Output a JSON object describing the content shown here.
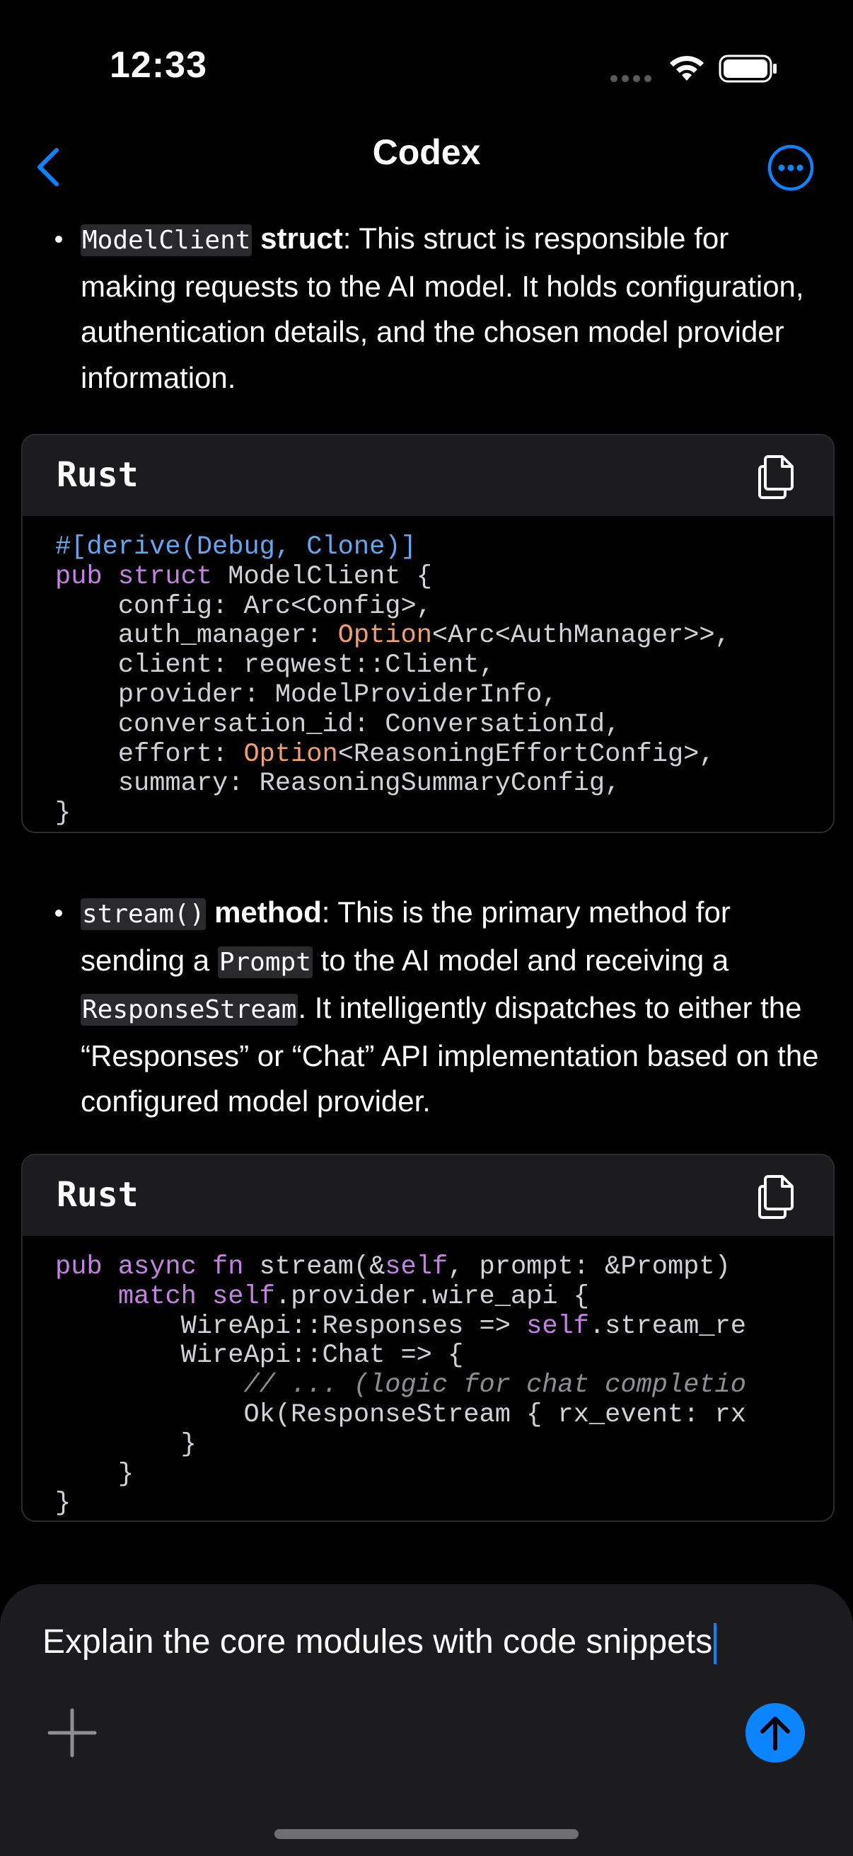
{
  "status_bar": {
    "time": "12:33"
  },
  "nav": {
    "title": "Codex"
  },
  "content": {
    "bullet1": {
      "code": "ModelClient",
      "bold": "struct",
      "text": ": This struct is responsible for making requests to the AI model. It holds configuration, authentication details, and the chosen model provider information."
    },
    "code_block1": {
      "language": "Rust",
      "lines": [
        "#[derive(Debug, Clone)]",
        "pub struct ModelClient {",
        "    config: Arc<Config>,",
        "    auth_manager: Option<Arc<AuthManager>>,",
        "    client: reqwest::Client,",
        "    provider: ModelProviderInfo,",
        "    conversation_id: ConversationId,",
        "    effort: Option<ReasoningEffortConfig>,",
        "    summary: ReasoningSummaryConfig,",
        "}"
      ]
    },
    "bullet2": {
      "code": "stream()",
      "bold": "method",
      "text_a": ": This is the primary method for sending a ",
      "code_b": "Prompt",
      "text_b": " to the AI model and receiving a ",
      "code_c": "ResponseStream",
      "text_c": ". It intelligently dispatches to either the “Responses” or “Chat” API implementation based on the configured model provider."
    },
    "code_block2": {
      "language": "Rust",
      "lines": [
        "pub async fn stream(&self, prompt: &Prompt)",
        "    match self.provider.wire_api {",
        "        WireApi::Responses => self.stream_re",
        "        WireApi::Chat => {",
        "            // ... (logic for chat completio",
        "            Ok(ResponseStream { rx_event: rx",
        "        }",
        "    }",
        "}"
      ]
    }
  },
  "composer": {
    "input_value": "Explain the core modules with code snippets"
  },
  "colors": {
    "accent": "#0a84ff",
    "background": "#000000",
    "code_keyword": "#c382e3",
    "code_attribute": "#62a8f0",
    "code_type": "#f0a070"
  },
  "icons": [
    "back-chevron-icon",
    "more-icon",
    "copy-icon",
    "plus-icon",
    "arrow-up-icon",
    "wifi-icon",
    "battery-icon"
  ]
}
